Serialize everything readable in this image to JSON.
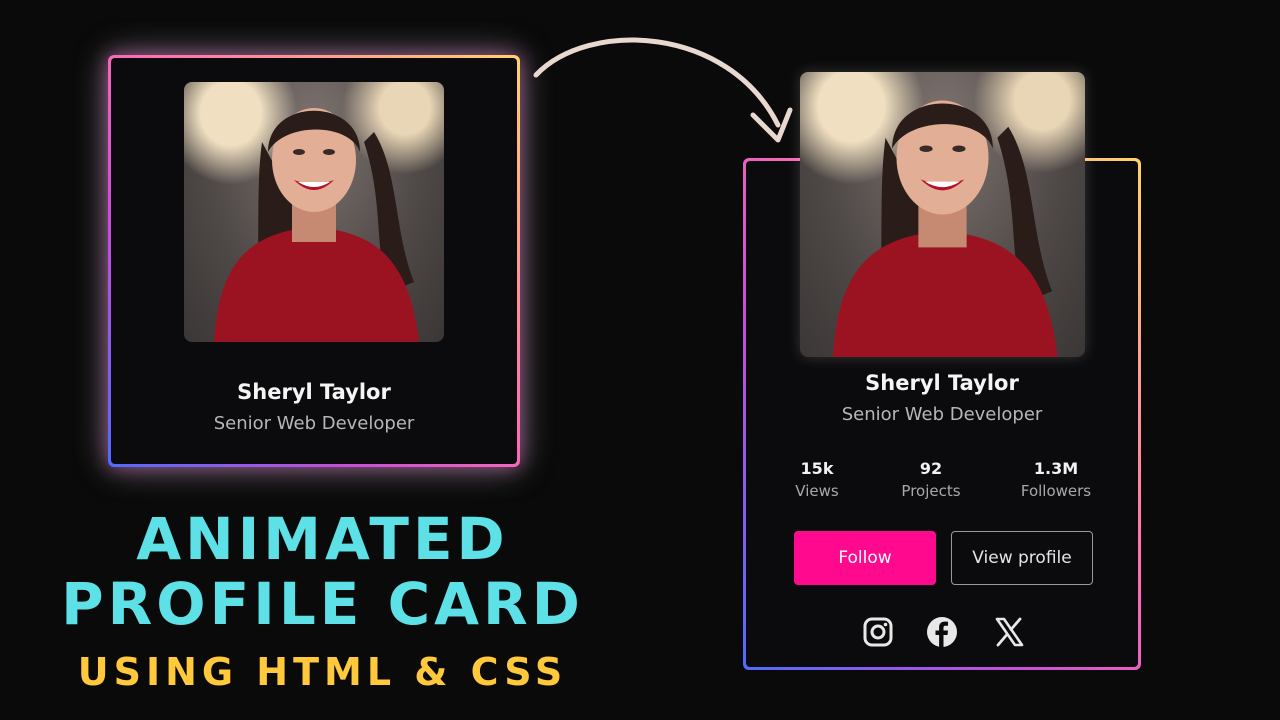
{
  "profile": {
    "name": "Sheryl Taylor",
    "role": "Senior Web Developer"
  },
  "stats": [
    {
      "value": "15k",
      "label": "Views"
    },
    {
      "value": "92",
      "label": "Projects"
    },
    {
      "value": "1.3M",
      "label": "Followers"
    }
  ],
  "buttons": {
    "follow": "Follow",
    "view_profile": "View profile"
  },
  "social_icons": [
    "instagram-icon",
    "facebook-icon",
    "x-icon"
  ],
  "title": {
    "line1": "ANIMATED",
    "line2": "PROFILE CARD",
    "subtitle": "USING HTML & CSS"
  },
  "colors": {
    "title": "#5de0e6",
    "subtitle": "#ffc93b",
    "follow_button": "#ff0a8f",
    "background": "#0a0a0a"
  }
}
